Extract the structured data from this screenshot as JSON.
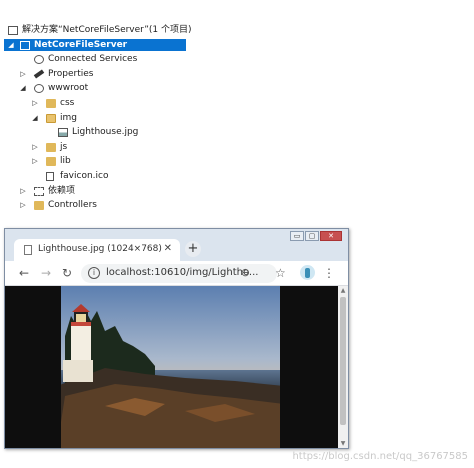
{
  "solution_explorer": {
    "solution_label": "解决方案“NetCoreFileServer”(1 个项目)",
    "project_label": "NetCoreFileServer",
    "items": [
      {
        "label": "Connected Services"
      },
      {
        "label": "Properties"
      },
      {
        "label": "wwwroot"
      },
      {
        "label": "css"
      },
      {
        "label": "img"
      },
      {
        "label": "Lighthouse.jpg"
      },
      {
        "label": "js"
      },
      {
        "label": "lib"
      },
      {
        "label": "favicon.ico"
      },
      {
        "label": "依赖项"
      },
      {
        "label": "Controllers"
      }
    ],
    "selected_color": "#0a73d1"
  },
  "browser": {
    "window_controls": {
      "minimize": "▭",
      "maximize": "▢",
      "close": "✕"
    },
    "tab": {
      "title": "Lighthouse.jpg (1024×768)",
      "close": "✕"
    },
    "new_tab": "+",
    "toolbar": {
      "back": "←",
      "forward": "→",
      "reload": "↻",
      "star": "☆",
      "menu": "⋮"
    },
    "address": {
      "info": "i",
      "url": "localhost:10610/img/Lightho...",
      "zoom": "⊖"
    }
  },
  "watermark": "https://blog.csdn.net/qq_36767585"
}
